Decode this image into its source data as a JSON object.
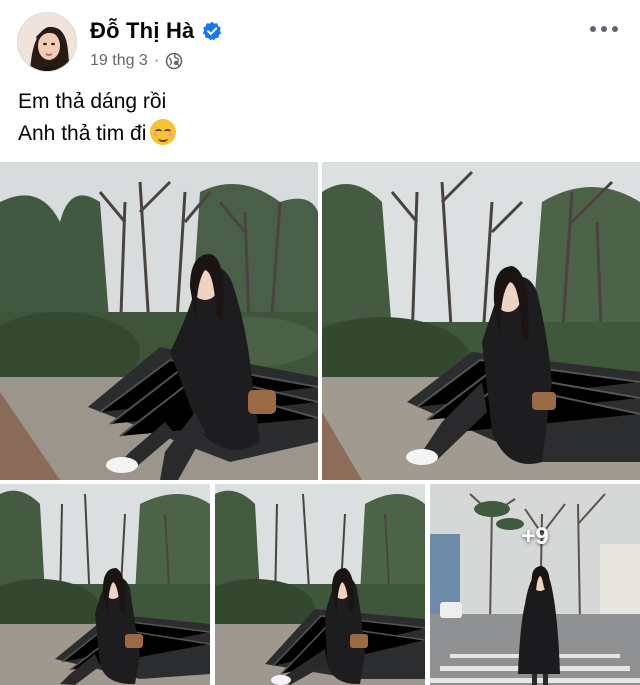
{
  "post": {
    "author_name": "Đỗ Thị Hà",
    "timestamp": "19 thg 3",
    "separator": "·",
    "caption_lines": [
      "Em thả dáng rồi",
      "Anh thả tim đi"
    ]
  },
  "icons": {
    "verified": "verified-badge-icon",
    "audience": "globe-icon",
    "menu": "more-options-icon",
    "caption_emoji": "smiling-face-icon"
  },
  "gallery": {
    "photo_count_shown": 5,
    "more_photos_label": "+9"
  },
  "colors": {
    "verified_blue": "#1877f2",
    "secondary_text": "#65676b",
    "primary_text": "#050505"
  }
}
